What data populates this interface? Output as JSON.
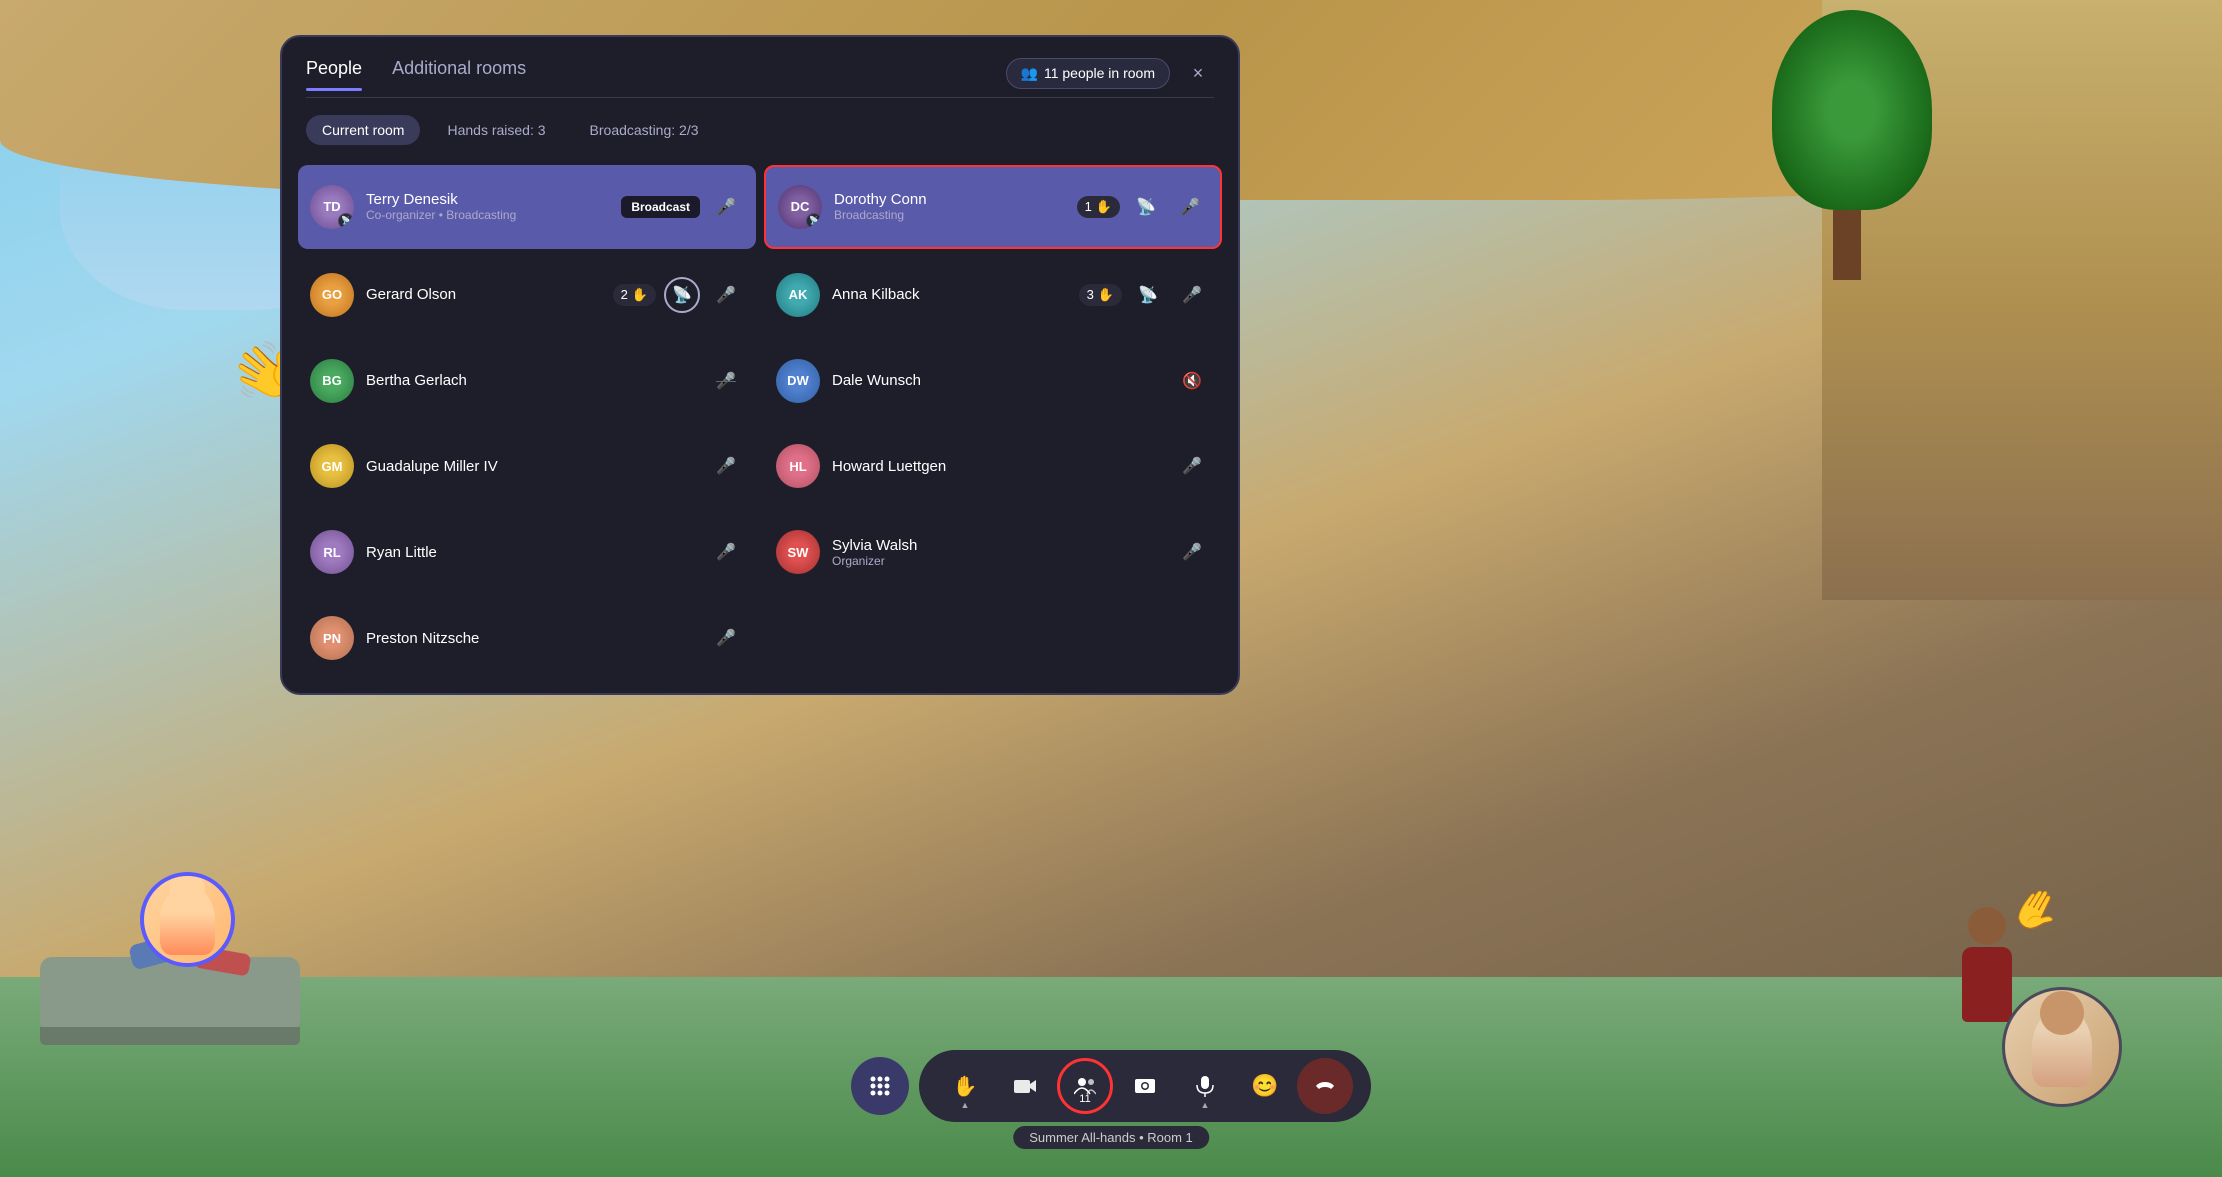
{
  "background": {
    "colors": {
      "sky": "#87CEEB",
      "ground": "#5a8a5a",
      "ceiling": "#c8a96e"
    }
  },
  "panel": {
    "tabs": [
      {
        "id": "people",
        "label": "People",
        "active": true
      },
      {
        "id": "rooms",
        "label": "Additional rooms",
        "active": false
      }
    ],
    "people_count_label": "11 people in room",
    "close_label": "×",
    "filters": [
      {
        "id": "current-room",
        "label": "Current room",
        "active": true
      },
      {
        "id": "hands-raised",
        "label": "Hands raised: 3",
        "active": false
      },
      {
        "id": "broadcasting",
        "label": "Broadcasting: 2/3",
        "active": false
      }
    ],
    "participants_left": [
      {
        "id": "terry",
        "name": "Terry Denesik",
        "role": "Co-organizer • Broadcasting",
        "highlighted": true,
        "avatar_color": "av-purple",
        "avatar_text": "TD",
        "hands": 0,
        "mic": "on",
        "broadcast_badge": "Broadcast",
        "has_broadcast_icon": true
      },
      {
        "id": "gerard",
        "name": "Gerard Olson",
        "role": "",
        "highlighted": false,
        "avatar_color": "av-orange",
        "avatar_text": "GO",
        "hands": 2,
        "mic": "on",
        "has_broadcast_icon": true
      },
      {
        "id": "bertha",
        "name": "Bertha Gerlach",
        "role": "",
        "highlighted": false,
        "avatar_color": "av-green",
        "avatar_text": "BG",
        "hands": 0,
        "mic": "off"
      },
      {
        "id": "guadalupe",
        "name": "Guadalupe Miller IV",
        "role": "",
        "highlighted": false,
        "avatar_color": "av-yellow",
        "avatar_text": "GM",
        "hands": 0,
        "mic": "on"
      },
      {
        "id": "ryan",
        "name": "Ryan Little",
        "role": "",
        "highlighted": false,
        "avatar_color": "av-lavender",
        "avatar_text": "RL",
        "hands": 0,
        "mic": "on"
      },
      {
        "id": "preston",
        "name": "Preston Nitzsche",
        "role": "",
        "highlighted": false,
        "avatar_color": "av-peach",
        "avatar_text": "PN",
        "hands": 0,
        "mic": "on"
      }
    ],
    "participants_right": [
      {
        "id": "dorothy",
        "name": "Dorothy Conn",
        "role": "Broadcasting",
        "highlighted": true,
        "red_border": true,
        "avatar_color": "av-dorothy",
        "avatar_text": "DC",
        "hands": 1,
        "mic": "on",
        "has_broadcast_icon": true
      },
      {
        "id": "anna",
        "name": "Anna Kilback",
        "role": "",
        "highlighted": false,
        "avatar_color": "av-teal",
        "avatar_text": "AK",
        "hands": 3,
        "mic": "on",
        "has_broadcast_icon": true
      },
      {
        "id": "dale",
        "name": "Dale Wunsch",
        "role": "",
        "highlighted": false,
        "avatar_color": "av-blue",
        "avatar_text": "DW",
        "hands": 0,
        "mic": "off"
      },
      {
        "id": "howard",
        "name": "Howard Luettgen",
        "role": "",
        "highlighted": false,
        "avatar_color": "av-pink",
        "avatar_text": "HL",
        "hands": 0,
        "mic": "on"
      },
      {
        "id": "sylvia",
        "name": "Sylvia Walsh",
        "role": "Organizer",
        "highlighted": false,
        "avatar_color": "av-red",
        "avatar_text": "SW",
        "hands": 0,
        "mic": "off"
      }
    ]
  },
  "toolbar": {
    "apps_label": "⠿",
    "raise_label": "✋",
    "camera_label": "📷",
    "people_label": "11",
    "photo_label": "📷",
    "mic_label": "🎤",
    "emoji_label": "😊",
    "end_label": "□",
    "session_label": "Summer All-hands • Room 1"
  }
}
